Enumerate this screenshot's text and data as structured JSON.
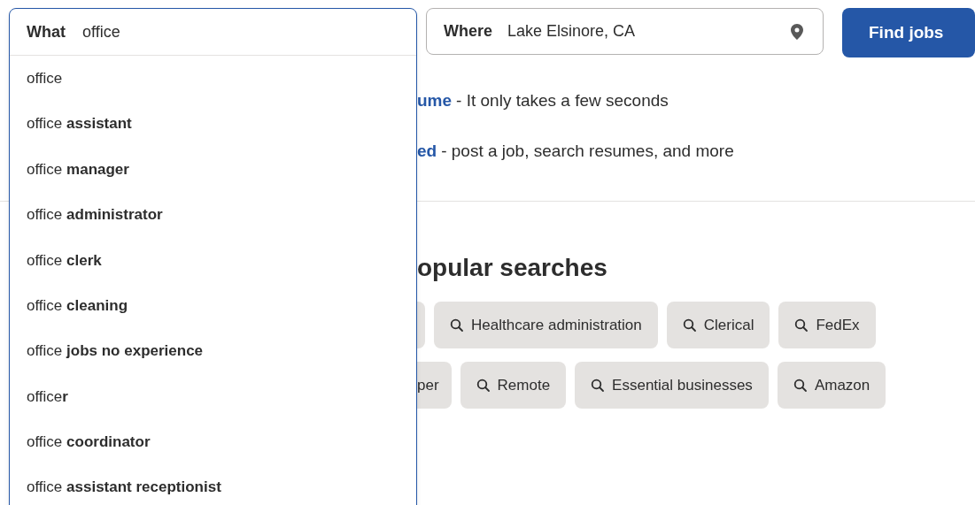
{
  "what_field": {
    "label": "What",
    "value": "office"
  },
  "suggestions": [
    {
      "text": "office"
    },
    {
      "text": "office **assistant**"
    },
    {
      "text": "office **manager**"
    },
    {
      "text": "office **administrator**"
    },
    {
      "text": "office **clerk**"
    },
    {
      "text": "office **cleaning**"
    },
    {
      "text": "office **jobs no experience**"
    },
    {
      "text": "office**r**"
    },
    {
      "text": "office **coordinator**"
    },
    {
      "text": "office **assistant receptionist**"
    }
  ],
  "where_field": {
    "label": "Where",
    "value": "Lake Elsinore, CA"
  },
  "find_button": "Find jobs",
  "promo_lines": [
    {
      "link": "ume",
      "text": "- It only takes a few seconds"
    },
    {
      "link": "ed",
      "text": "- post a job, search resumes, and more"
    }
  ],
  "popular": {
    "heading": "opular searches",
    "rows": [
      [
        {
          "kind": "cut"
        },
        {
          "kind": "chip",
          "label": "Healthcare administration"
        },
        {
          "kind": "chip",
          "label": "Clerical"
        },
        {
          "kind": "chip",
          "label": "FedEx"
        }
      ],
      [
        {
          "kind": "cut",
          "label": "per"
        },
        {
          "kind": "chip",
          "label": "Remote"
        },
        {
          "kind": "chip",
          "label": "Essential businesses"
        },
        {
          "kind": "chip",
          "label": "Amazon"
        }
      ]
    ]
  }
}
